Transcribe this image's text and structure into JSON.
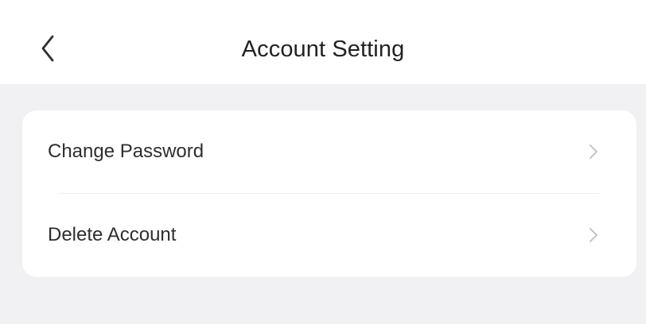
{
  "header": {
    "title": "Account Setting",
    "back_icon": "chevron-left-icon"
  },
  "settings": {
    "items": [
      {
        "label": "Change Password",
        "icon": "chevron-right-icon"
      },
      {
        "label": "Delete Account",
        "icon": "chevron-right-icon"
      }
    ]
  },
  "colors": {
    "background": "#F1F1F3",
    "card": "#FFFFFF",
    "text": "#2E2E2E",
    "chevron": "#BEBEBE"
  }
}
